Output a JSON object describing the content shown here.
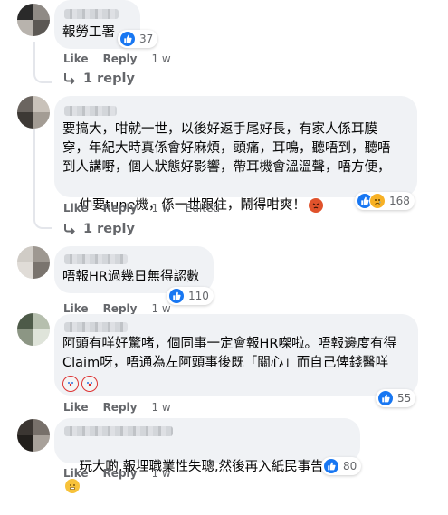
{
  "comments": [
    {
      "text": "報勞工署",
      "reaction_count": "37",
      "like_label": "Like",
      "reply_label": "Reply",
      "time": "1 w",
      "replies_label": "1 reply"
    },
    {
      "text_lines": [
        "要搞大，咁就一世，以後好返手尾好長，有家人係耳膜",
        "穿，年紀大時真係會好麻煩，頭痛，耳鳴，聽唔到，聽唔",
        "到人講嘢，個人狀態好影響，帶耳機會溫溫聲，唔方便，",
        "仲要tune機，係一世跟住，鬧得咁爽！"
      ],
      "reaction_count": "168",
      "like_label": "Like",
      "reply_label": "Reply",
      "time": "1 w",
      "edited_label": "Edited",
      "replies_label": "1 reply"
    },
    {
      "text": "唔報HR過幾日無得認數",
      "reaction_count": "110",
      "like_label": "Like",
      "reply_label": "Reply",
      "time": "1 w"
    },
    {
      "text_lines": [
        "阿頭有咩好驚啫，個同事一定會報HR㗎啦。唔報邊度有得",
        "Claim呀，唔通為左阿頭事後既「關心」而自己俾錢醫咩"
      ],
      "reaction_count": "55",
      "like_label": "Like",
      "reply_label": "Reply",
      "time": "1 w"
    },
    {
      "text": "玩大啲,報埋職業性失聰,然後再入紙民事告9佢",
      "reaction_count": "80",
      "like_label": "Like",
      "reply_label": "Reply",
      "time": "1 w"
    }
  ],
  "colors": {
    "bubble": "#f0f2f5",
    "meta_text": "#65676b",
    "like_blue": "#1877f2",
    "sad_yellow": "#f7b125"
  },
  "icons": {
    "like": "thumbs-up-icon",
    "sad": "sad-face-icon",
    "reply_arrow": "reply-arrow-icon",
    "angry_emoji": "angry-face-emoji",
    "clown_emoji": "clown-face-emoji",
    "grimace_emoji": "sweat-smile-emoji"
  }
}
